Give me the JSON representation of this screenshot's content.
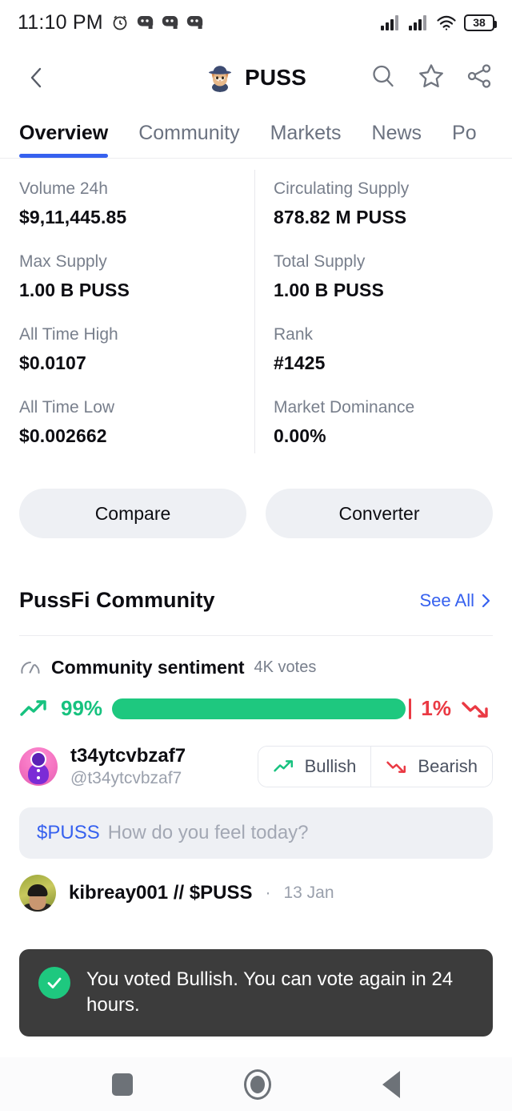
{
  "status_bar": {
    "time": "11:10 PM",
    "icons": [
      "alarm-clock-icon",
      "discord-notification-icon",
      "discord-notification-icon",
      "discord-notification-icon"
    ],
    "right_icons": [
      "signal-bars-icon",
      "signal-bars-icon",
      "wifi-icon"
    ],
    "battery_level": "38"
  },
  "app_bar": {
    "back_icon": "chevron-left-icon",
    "logo": "cat-in-blue-hat-logo",
    "title": "PUSS",
    "actions": [
      "search-icon",
      "star-outline-icon",
      "share-icon"
    ]
  },
  "tabs": {
    "items": [
      {
        "label": "Overview",
        "active": true
      },
      {
        "label": "Community",
        "active": false
      },
      {
        "label": "Markets",
        "active": false
      },
      {
        "label": "News",
        "active": false
      },
      {
        "label": "Po",
        "active": false
      }
    ],
    "active_underline_color": "#3661ef"
  },
  "stats": [
    {
      "label": "Volume 24h",
      "value": "$9,11,445.85"
    },
    {
      "label": "Circulating Supply",
      "value": "878.82 M PUSS"
    },
    {
      "label": "Max Supply",
      "value": "1.00 B PUSS"
    },
    {
      "label": "Total Supply",
      "value": "1.00 B PUSS"
    },
    {
      "label": "All Time High",
      "value": "$0.0107"
    },
    {
      "label": "Rank",
      "value": "#1425"
    },
    {
      "label": "All Time Low",
      "value": "$0.002662"
    },
    {
      "label": "Market Dominance",
      "value": "0.00%"
    }
  ],
  "action_buttons": {
    "compare": "Compare",
    "converter": "Converter"
  },
  "community": {
    "section_title": "PussFi Community",
    "see_all": "See All",
    "see_all_icon": "chevron-right-icon",
    "sentiment": {
      "gauge_icon": "speedometer-icon",
      "title": "Community sentiment",
      "votes": "4K votes",
      "bullish_pct_label": "99%",
      "bearish_pct_label": "1%",
      "bullish_pct": 99,
      "bearish_pct": 1,
      "bullish_icon": "trend-up-icon",
      "bearish_icon": "trend-down-icon",
      "bullish_color": "#1ec87f",
      "bearish_color": "#ea3943"
    },
    "voter": {
      "avatar": "purple-snowman-avatar",
      "name": "t34ytcvbzaf7",
      "handle": "@t34ytcvbzaf7",
      "bullish_label": "Bullish",
      "bearish_label": "Bearish"
    },
    "composer": {
      "ticker": "$PUSS",
      "placeholder": "How do you feel today?"
    },
    "post": {
      "avatar": "user-photo-avatar",
      "name": "kibreay001 // $PUSS",
      "separator": "·",
      "date": "13 Jan"
    }
  },
  "toast": {
    "icon": "check-circle-icon",
    "message": "You voted Bullish. You can vote again in 24 hours."
  },
  "nav_bar": {
    "recents": "square-recents-icon",
    "home": "circle-home-icon",
    "back": "triangle-back-icon"
  }
}
